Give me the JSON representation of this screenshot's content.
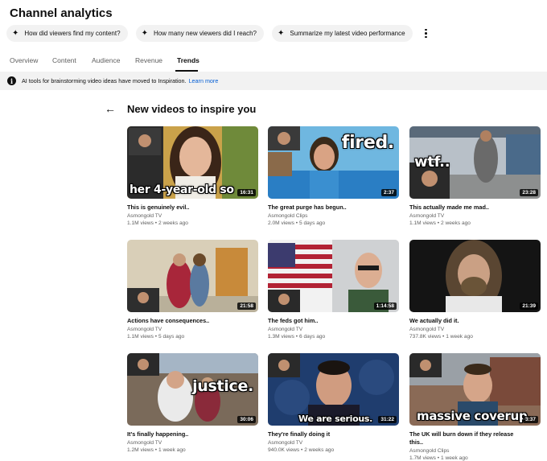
{
  "header": {
    "title": "Channel analytics"
  },
  "chips": [
    {
      "label": "How did viewers find my content?"
    },
    {
      "label": "How many new viewers did I reach?"
    },
    {
      "label": "Summarize my latest video performance"
    }
  ],
  "tabs": [
    {
      "label": "Overview",
      "active": false
    },
    {
      "label": "Content",
      "active": false
    },
    {
      "label": "Audience",
      "active": false
    },
    {
      "label": "Revenue",
      "active": false
    },
    {
      "label": "Trends",
      "active": true
    }
  ],
  "banner": {
    "text": "AI tools for brainstorming video ideas have moved to Inspiration.",
    "link": "Learn more"
  },
  "section": {
    "title": "New videos to inspire you"
  },
  "videos": [
    {
      "title": "This is genuinely evil..",
      "title2": "",
      "channel": "Asmongold TV",
      "meta": "1.1M views • 2 weeks ago",
      "duration": "16:31",
      "overlay": "her 4-year-old so"
    },
    {
      "title": "The great purge has begun..",
      "title2": "",
      "channel": "Asmongold Clips",
      "meta": "2.0M views • 5 days ago",
      "duration": "2:37",
      "overlay": "fired."
    },
    {
      "title": "This actually made me mad..",
      "title2": "",
      "channel": "Asmongold TV",
      "meta": "1.1M views • 2 weeks ago",
      "duration": "23:28",
      "overlay": "wtf.."
    },
    {
      "title": "Actions have consequences..",
      "title2": "",
      "channel": "Asmongold TV",
      "meta": "1.1M views • 5 days ago",
      "duration": "21:58",
      "overlay": ""
    },
    {
      "title": "The feds got him..",
      "title2": "",
      "channel": "Asmongold TV",
      "meta": "1.3M views • 6 days ago",
      "duration": "1:14:58",
      "overlay": ""
    },
    {
      "title": "We actually did it.",
      "title2": "",
      "channel": "Asmongold TV",
      "meta": "737.8K views • 1 week ago",
      "duration": "21:39",
      "overlay": ""
    },
    {
      "title": "It's finally happening..",
      "title2": "",
      "channel": "Asmongold TV",
      "meta": "1.2M views • 1 week ago",
      "duration": "30:06",
      "overlay": "justice."
    },
    {
      "title": "They're finally doing it",
      "title2": "",
      "channel": "Asmongold TV",
      "meta": "940.0K views • 2 weeks ago",
      "duration": "31:22",
      "overlay": "We are serious."
    },
    {
      "title": "The UK will burn down if they release",
      "title2": "this..",
      "channel": "Asmongold Clips",
      "meta": "1.7M views • 1 week ago",
      "duration": "3:37",
      "overlay": "massive coverup"
    }
  ]
}
